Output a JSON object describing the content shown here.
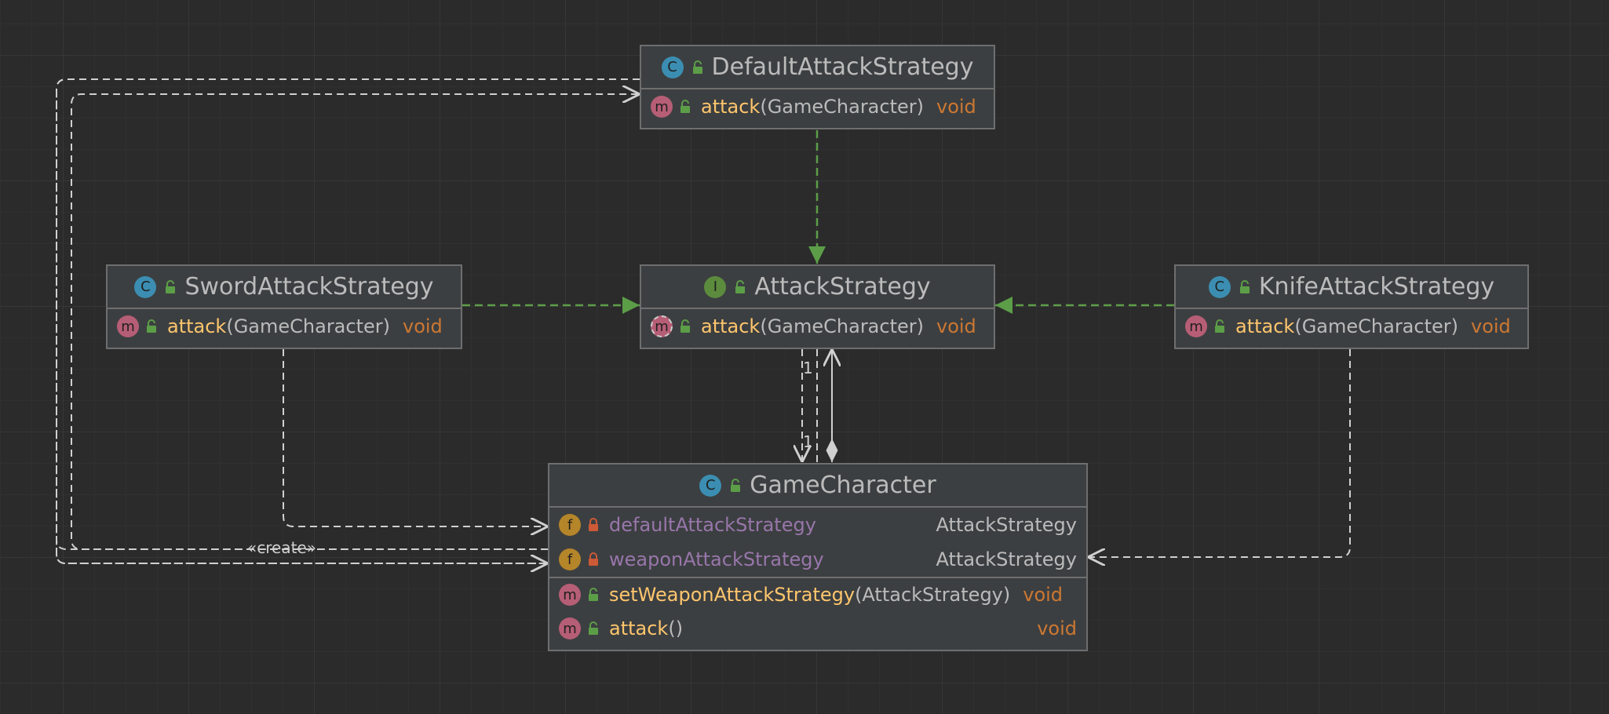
{
  "nodes": {
    "default_attack_strategy": {
      "kind": "C",
      "name": "DefaultAttackStrategy",
      "methods": [
        {
          "kind": "m",
          "name": "attack",
          "params": "(GameCharacter)",
          "return": "void"
        }
      ]
    },
    "attack_strategy": {
      "kind": "I",
      "name": "AttackStrategy",
      "methods": [
        {
          "kind": "m",
          "name": "attack",
          "params": "(GameCharacter)",
          "return": "void"
        }
      ]
    },
    "sword_attack_strategy": {
      "kind": "C",
      "name": "SwordAttackStrategy",
      "methods": [
        {
          "kind": "m",
          "name": "attack",
          "params": "(GameCharacter)",
          "return": "void"
        }
      ]
    },
    "knife_attack_strategy": {
      "kind": "C",
      "name": "KnifeAttackStrategy",
      "methods": [
        {
          "kind": "m",
          "name": "attack",
          "params": "(GameCharacter)",
          "return": "void"
        }
      ]
    },
    "game_character": {
      "kind": "C",
      "name": "GameCharacter",
      "fields": [
        {
          "kind": "f",
          "name": "defaultAttackStrategy",
          "type": "AttackStrategy"
        },
        {
          "kind": "f",
          "name": "weaponAttackStrategy",
          "type": "AttackStrategy"
        }
      ],
      "methods": [
        {
          "kind": "m",
          "name": "setWeaponAttackStrategy",
          "params": "(AttackStrategy)",
          "return": "void"
        },
        {
          "kind": "m",
          "name": "attack",
          "params": "()",
          "return": "void"
        }
      ]
    }
  },
  "edge_labels": {
    "create": "«create»",
    "mult_top": "1",
    "mult_bottom": "1"
  },
  "colors": {
    "background": "#2b2b2b",
    "node_fill": "#3c3f41",
    "node_border": "#6e6e6e",
    "realization_edge": "#5c9e48",
    "dependency_edge": "#d0d0d0",
    "method_name": "#ffc66d",
    "field_name": "#9876aa",
    "return_type": "#cc7832"
  }
}
